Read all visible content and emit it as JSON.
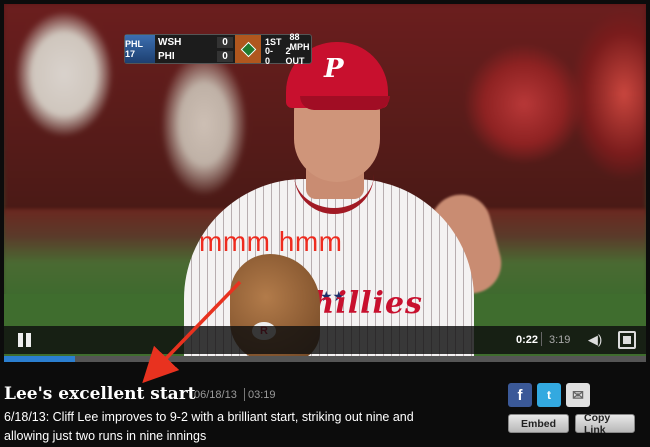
{
  "scorebug": {
    "network": "PHL 17",
    "away": {
      "team": "WSH",
      "score": "0"
    },
    "home": {
      "team": "PHI",
      "score": "0"
    },
    "inning": "1ST",
    "pitch_speed": "88 MPH",
    "count": "0-0",
    "outs": "2 OUT"
  },
  "video": {
    "cap_logo": "P",
    "jersey_text": "Phillies",
    "glove_logo": "R",
    "annotation": "mmm hmm",
    "annotation_color": "#ee2b1f"
  },
  "controls": {
    "current_time": "0:22",
    "duration": "3:19",
    "progress": 0.11,
    "accent": "#2b7fd0"
  },
  "info": {
    "title": "Lee's excellent start",
    "date": "06/18/13",
    "length": "03:19",
    "description": "6/18/13: Cliff Lee improves to 9-2 with a brilliant start, striking out nine and allowing just two runs in nine innings"
  },
  "share": {
    "facebook": "f",
    "twitter": "t",
    "email": "✉",
    "embed_label": "Embed",
    "copy_label": "Copy Link"
  }
}
